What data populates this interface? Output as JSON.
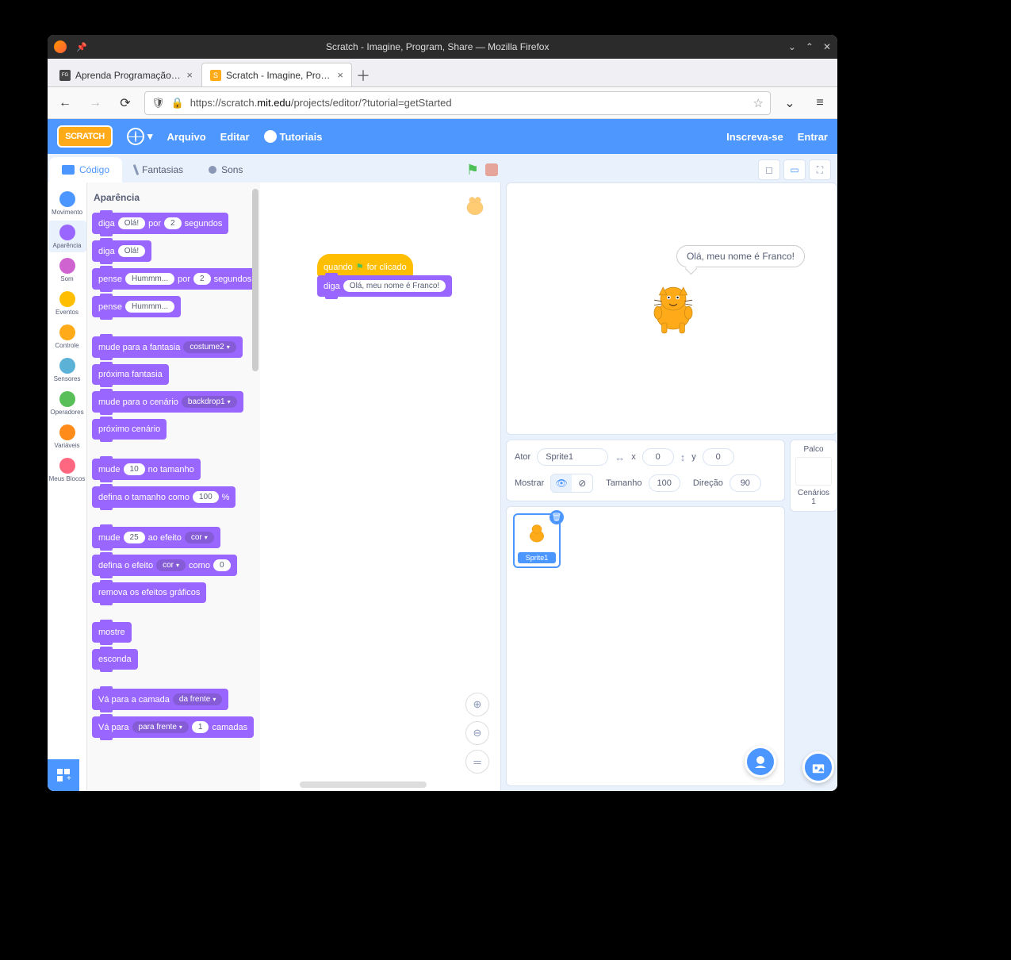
{
  "window": {
    "title": "Scratch - Imagine, Program, Share — Mozilla Firefox"
  },
  "tabs": [
    {
      "label": "Aprenda Programação: Ponto",
      "active": false
    },
    {
      "label": "Scratch - Imagine, Program, S",
      "active": true
    }
  ],
  "url": {
    "prefix": "https://scratch.",
    "domain": "mit.edu",
    "suffix": "/projects/editor/?tutorial=getStarted"
  },
  "scratch_header": {
    "logo": "SCRATCH",
    "file": "Arquivo",
    "edit": "Editar",
    "tutorials": "Tutoriais",
    "signup": "Inscreva-se",
    "login": "Entrar"
  },
  "editor_tabs": {
    "code": "Código",
    "costumes": "Fantasias",
    "sounds": "Sons"
  },
  "categories": [
    {
      "label": "Movimento",
      "color": "#4c97ff"
    },
    {
      "label": "Aparência",
      "color": "#9966ff",
      "sel": true
    },
    {
      "label": "Som",
      "color": "#cf63cf"
    },
    {
      "label": "Eventos",
      "color": "#ffbf00"
    },
    {
      "label": "Controle",
      "color": "#ffab19"
    },
    {
      "label": "Sensores",
      "color": "#5cb1d6"
    },
    {
      "label": "Operadores",
      "color": "#59c059"
    },
    {
      "label": "Variáveis",
      "color": "#ff8c1a"
    },
    {
      "label": "Meus Blocos",
      "color": "#ff6680"
    }
  ],
  "palette": {
    "title": "Aparência",
    "blocks": {
      "say_for": {
        "op": "diga",
        "val": "Olá!",
        "por": "por",
        "secs": "2",
        "unit": "segundos"
      },
      "say": {
        "op": "diga",
        "val": "Olá!"
      },
      "think_for": {
        "op": "pense",
        "val": "Hummm...",
        "por": "por",
        "secs": "2",
        "unit": "segundos"
      },
      "think": {
        "op": "pense",
        "val": "Hummm..."
      },
      "switch_costume": {
        "op": "mude para a fantasia",
        "dd": "costume2"
      },
      "next_costume": {
        "op": "próxima fantasia"
      },
      "switch_backdrop": {
        "op": "mude para o cenário",
        "dd": "backdrop1"
      },
      "next_backdrop": {
        "op": "próximo cenário"
      },
      "change_size": {
        "op": "mude",
        "val": "10",
        "suf": "no tamanho"
      },
      "set_size": {
        "op": "defina o tamanho como",
        "val": "100",
        "suf": "%"
      },
      "change_effect": {
        "op": "mude",
        "val": "25",
        "mid": "ao efeito",
        "dd": "cor"
      },
      "set_effect": {
        "op": "defina o efeito",
        "dd": "cor",
        "mid": "como",
        "val": "0"
      },
      "clear_effects": {
        "op": "remova os efeitos gráficos"
      },
      "show": {
        "op": "mostre"
      },
      "hide": {
        "op": "esconda"
      },
      "go_layer": {
        "op": "Vá para a camada",
        "dd": "da frente"
      },
      "go_layers": {
        "op": "Vá para",
        "dd": "para frente",
        "val": "1",
        "suf": "camadas"
      }
    }
  },
  "workspace": {
    "hat": {
      "pre": "quando",
      "post": "for clicado"
    },
    "say": {
      "op": "diga",
      "val": "Olá, meu nome é Franco!"
    }
  },
  "stage": {
    "bubble": "Olá, meu nome é Franco!"
  },
  "sprite_info": {
    "actor_label": "Ator",
    "actor_name": "Sprite1",
    "x_label": "x",
    "x": "0",
    "y_label": "y",
    "y": "0",
    "show_label": "Mostrar",
    "size_label": "Tamanho",
    "size": "100",
    "dir_label": "Direção",
    "dir": "90"
  },
  "sprite_thumb_name": "Sprite1",
  "stage_panel": {
    "title": "Palco",
    "backdrops": "Cenários",
    "count": "1"
  }
}
